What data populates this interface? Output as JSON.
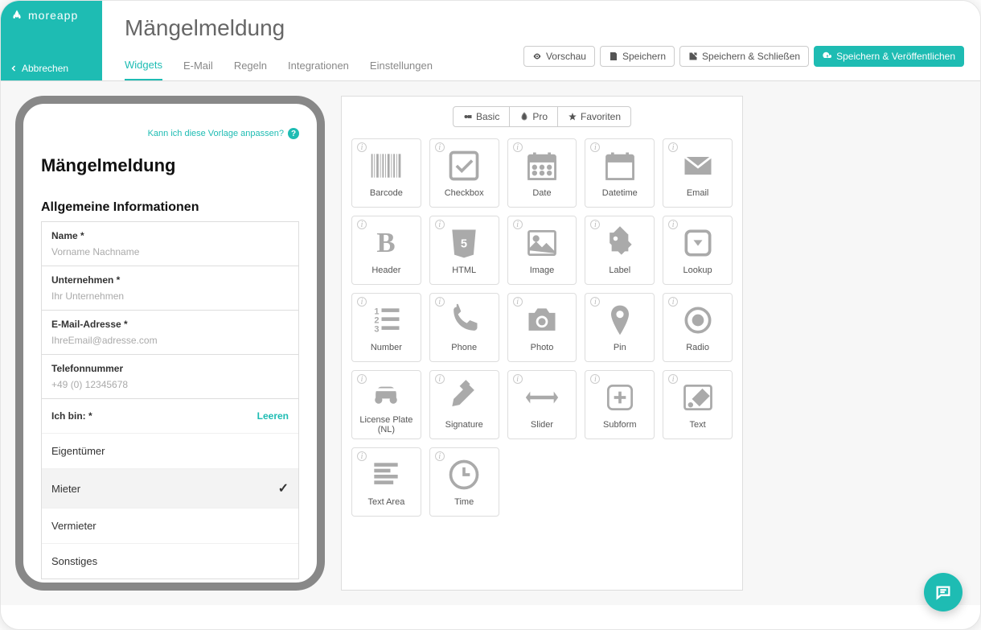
{
  "brand": "moreapp",
  "cancel": "Abbrechen",
  "page_title": "Mängelmeldung",
  "tabs": [
    "Widgets",
    "E-Mail",
    "Regeln",
    "Integrationen",
    "Einstellungen"
  ],
  "active_tab": 0,
  "actions": {
    "preview": "Vorschau",
    "save": "Speichern",
    "save_close": "Speichern & Schließen",
    "save_publish": "Speichern & Veröffentlichen"
  },
  "help_link": "Kann ich diese Vorlage anpassen?",
  "form": {
    "title": "Mängelmeldung",
    "section": "Allgemeine Informationen",
    "fields": [
      {
        "label": "Name *",
        "placeholder": "Vorname Nachname"
      },
      {
        "label": "Unternehmen *",
        "placeholder": "Ihr Unternehmen"
      },
      {
        "label": "E-Mail-Adresse *",
        "placeholder": "IhreEmail@adresse.com"
      },
      {
        "label": "Telefonnummer",
        "placeholder": "+49 (0) 12345678"
      }
    ],
    "radio": {
      "label": "Ich bin: *",
      "clear": "Leeren",
      "options": [
        "Eigentümer",
        "Mieter",
        "Vermieter",
        "Sonstiges"
      ],
      "selected": 1
    }
  },
  "widget_tabs": [
    "Basic",
    "Pro",
    "Favoriten"
  ],
  "widgets": [
    "Barcode",
    "Checkbox",
    "Date",
    "Datetime",
    "Email",
    "Header",
    "HTML",
    "Image",
    "Label",
    "Lookup",
    "Number",
    "Phone",
    "Photo",
    "Pin",
    "Radio",
    "License Plate (NL)",
    "Signature",
    "Slider",
    "Subform",
    "Text",
    "Text Area",
    "Time"
  ]
}
